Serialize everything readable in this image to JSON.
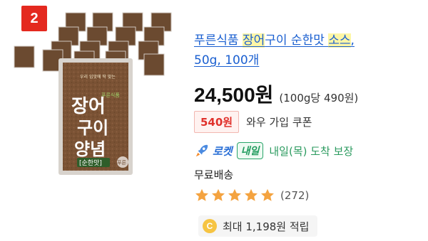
{
  "rank": "2",
  "product": {
    "title_parts": [
      "푸른식품 ",
      "장어",
      "구이 순한맛 ",
      "소스",
      ","
    ],
    "title_line2": "50g, 100개",
    "price": "24,500원",
    "unit_price": "(100g당 490원)",
    "image_text": {
      "brand": "푸른식품",
      "tagline": "우리 입맛에 딱 맞는",
      "name_line1": "장어",
      "name_line2": "구이",
      "name_line3": "양념",
      "flavor": "[순한맛]",
      "stamp": "푸른"
    }
  },
  "coupon": {
    "amount": "540원",
    "label": "와우 가입 쿠폰"
  },
  "delivery": {
    "rocket_label": "로켓",
    "tomorrow_badge": "내일",
    "arrival_text": "내일(목) 도착 보장",
    "free_shipping": "무료배송"
  },
  "rating": {
    "stars": 5,
    "review_count": "(272)"
  },
  "cashback": {
    "coin_letter": "C",
    "text": "최대 1,198원 적립"
  },
  "colors": {
    "badge": "#e4291f",
    "title_link": "#1a5fd0",
    "highlight": "#fdf6a6",
    "coupon": "#e0312b",
    "rocket": "#2a6fd6",
    "arrival": "#2a9a5e",
    "star": "#f4a340"
  }
}
